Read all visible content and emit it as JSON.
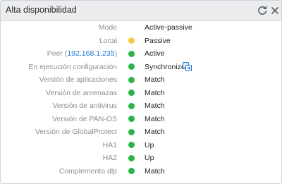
{
  "widget": {
    "title": "Alta disponibilidad",
    "header_icons": [
      "refresh-icon",
      "close-icon"
    ]
  },
  "colors": {
    "green": "#2ab349",
    "yellow": "#f7c948",
    "link": "#1a76d2",
    "label": "#8a8e93"
  },
  "rows": [
    {
      "label": "Mode",
      "value": "Active-passive",
      "status": "none"
    },
    {
      "label": "Local",
      "value": "Passive",
      "status": "yellow"
    },
    {
      "label_prefix": "Peer (",
      "peer_ip": "192.168.1.235",
      "label_suffix": ")",
      "value": "Active",
      "status": "green"
    },
    {
      "label": "En ejecución configuración",
      "value": "Synchronized",
      "status": "green",
      "icon": "sync-config-icon"
    },
    {
      "label": "Versión de aplicaciones",
      "value": "Match",
      "status": "green"
    },
    {
      "label": "Versión de amenazas",
      "value": "Match",
      "status": "green"
    },
    {
      "label": "Versión de antivirus",
      "value": "Match",
      "status": "green"
    },
    {
      "label": "Versión de PAN-OS",
      "value": "Match",
      "status": "green"
    },
    {
      "label": "Versión de GlobalProtect",
      "value": "Match",
      "status": "green"
    },
    {
      "label": "HA1",
      "value": "Up",
      "status": "green"
    },
    {
      "label": "HA2",
      "value": "Up",
      "status": "green"
    },
    {
      "label": "Complemento dlp",
      "value": "Match",
      "status": "green"
    }
  ]
}
